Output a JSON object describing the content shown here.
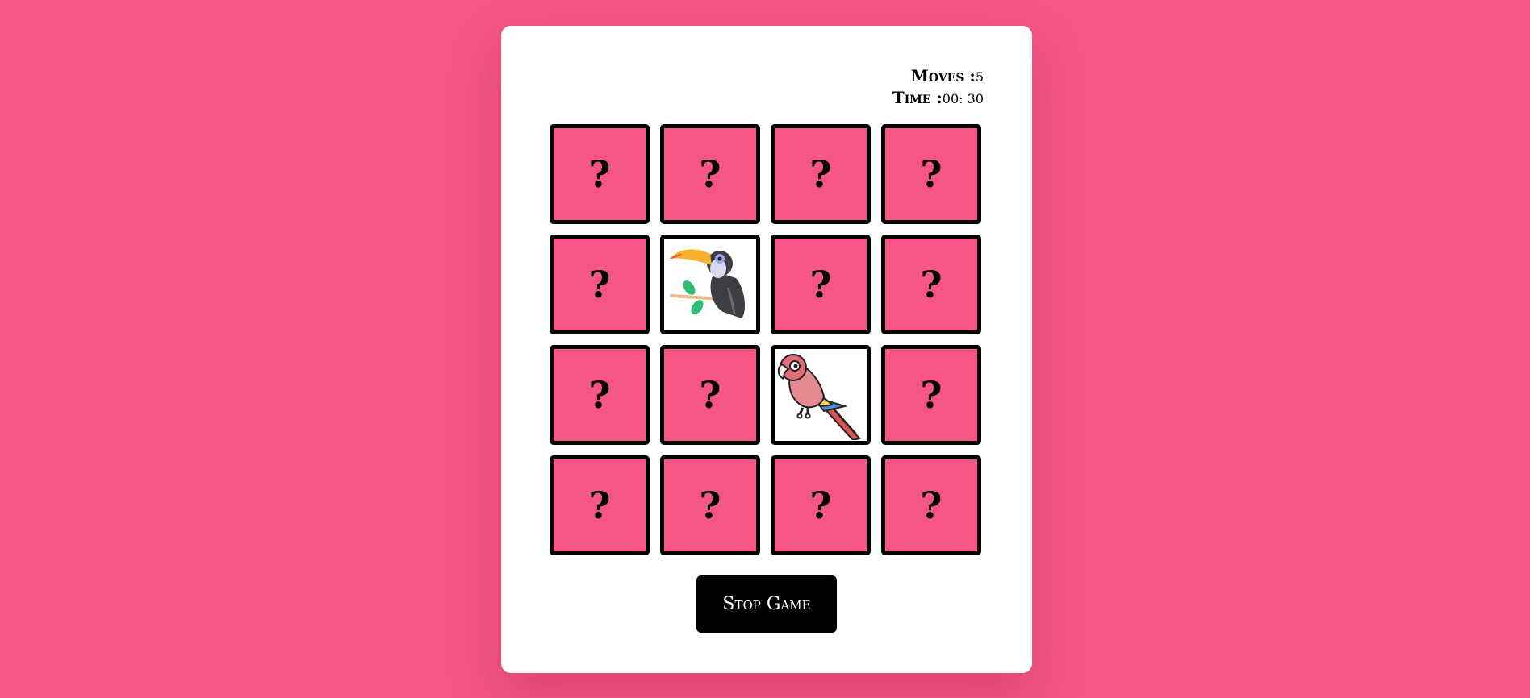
{
  "stats": {
    "moves_label": "Moves :",
    "moves_value": "5",
    "time_label": "Time :",
    "time_value": "00: 30"
  },
  "cards": [
    {
      "state": "hidden",
      "mark": "?"
    },
    {
      "state": "hidden",
      "mark": "?"
    },
    {
      "state": "hidden",
      "mark": "?"
    },
    {
      "state": "hidden",
      "mark": "?"
    },
    {
      "state": "hidden",
      "mark": "?"
    },
    {
      "state": "revealed",
      "image": "toucan-icon"
    },
    {
      "state": "hidden",
      "mark": "?"
    },
    {
      "state": "hidden",
      "mark": "?"
    },
    {
      "state": "hidden",
      "mark": "?"
    },
    {
      "state": "hidden",
      "mark": "?"
    },
    {
      "state": "revealed",
      "image": "parrot-icon"
    },
    {
      "state": "hidden",
      "mark": "?"
    },
    {
      "state": "hidden",
      "mark": "?"
    },
    {
      "state": "hidden",
      "mark": "?"
    },
    {
      "state": "hidden",
      "mark": "?"
    },
    {
      "state": "hidden",
      "mark": "?"
    }
  ],
  "stop_button": {
    "label": "Stop Game"
  },
  "colors": {
    "background": "#f55686",
    "card_back": "#f55686",
    "card_border": "#000000",
    "panel": "#ffffff",
    "button": "#000000"
  }
}
